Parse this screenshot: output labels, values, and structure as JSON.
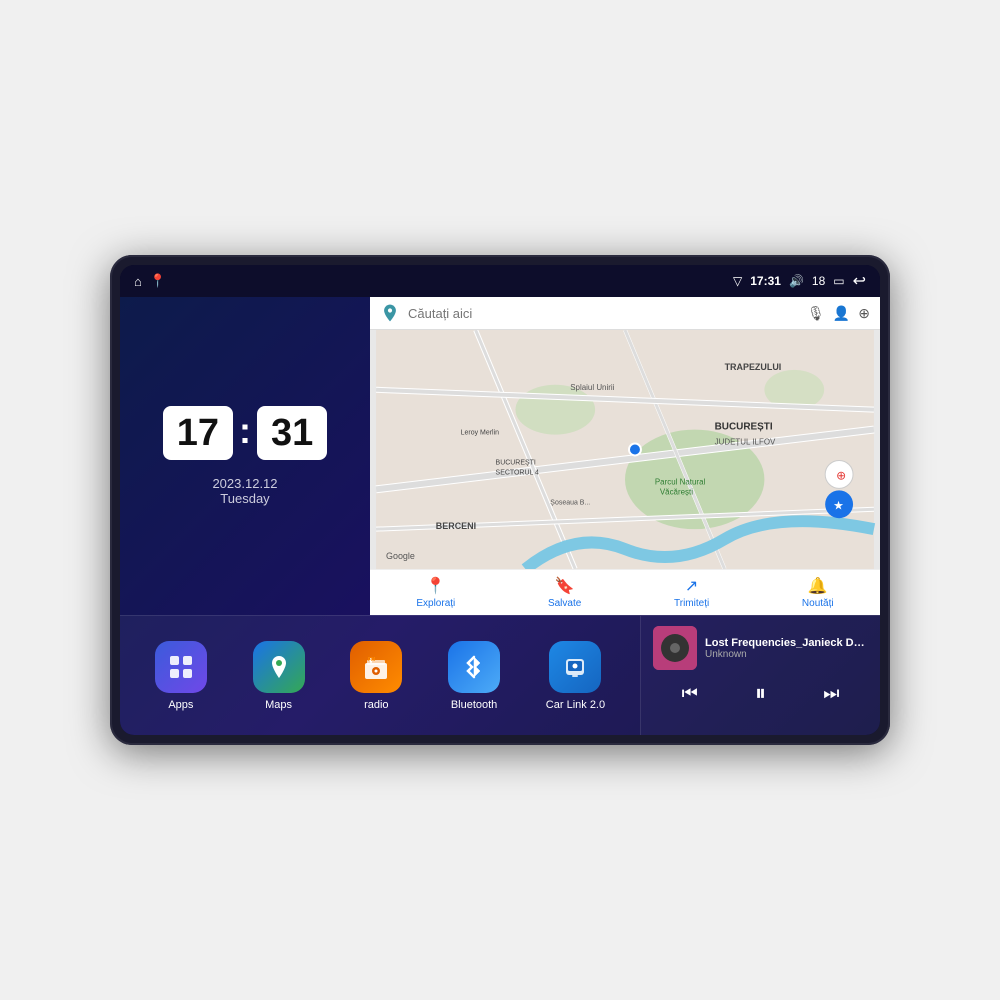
{
  "device": {
    "status_bar": {
      "left_icons": [
        "home",
        "maps"
      ],
      "time": "17:31",
      "signal_icon": "signal",
      "volume_icon": "volume",
      "volume_level": "18",
      "battery_icon": "battery",
      "back_icon": "back"
    },
    "clock": {
      "hour": "17",
      "minute": "31",
      "date": "2023.12.12",
      "day": "Tuesday"
    },
    "map": {
      "search_placeholder": "Căutați aici",
      "labels": {
        "trapezului": "TRAPEZULUI",
        "bucuresti": "BUCUREȘTI",
        "judet": "JUDEȚUL ILFOV",
        "berceni": "BERCENI",
        "parc": "Parcul Natural Văcărești",
        "leroy": "Leroy Merlin",
        "sector": "BUCUREȘTI\nSECTORUL 4",
        "splaiul": "Splaiul Unirii"
      },
      "bottom_items": [
        {
          "icon": "📍",
          "label": "Explorați"
        },
        {
          "icon": "🔖",
          "label": "Salvate"
        },
        {
          "icon": "↗",
          "label": "Trimiteți"
        },
        {
          "icon": "🔔",
          "label": "Noutăți"
        }
      ]
    },
    "apps": [
      {
        "name": "apps",
        "label": "Apps",
        "icon": "⊞",
        "bg": "apps-bg"
      },
      {
        "name": "maps",
        "label": "Maps",
        "icon": "📍",
        "bg": "maps-bg"
      },
      {
        "name": "radio",
        "label": "radio",
        "icon": "📻",
        "bg": "radio-bg"
      },
      {
        "name": "bluetooth",
        "label": "Bluetooth",
        "icon": "Ϡ",
        "bg": "bt-bg"
      },
      {
        "name": "carlink",
        "label": "Car Link 2.0",
        "icon": "📱",
        "bg": "carlink-bg"
      }
    ],
    "music": {
      "title": "Lost Frequencies_Janieck Devy-...",
      "artist": "Unknown",
      "controls": {
        "prev": "⏮",
        "play": "⏸",
        "next": "⏭"
      }
    }
  }
}
